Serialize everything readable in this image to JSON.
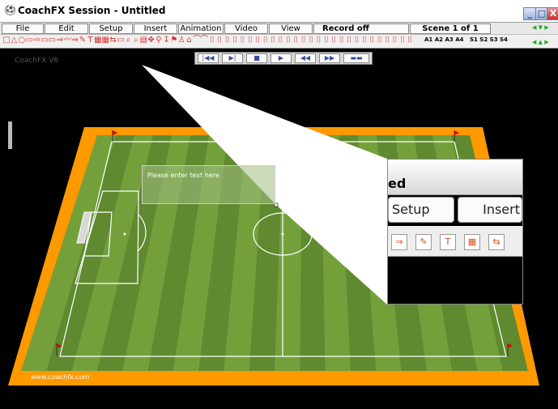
{
  "window": {
    "title": "CoachFX Session - Untitled",
    "app_icon": "soccer-ball-icon"
  },
  "window_controls": {
    "minimize": "_",
    "maximize": "□",
    "close": "X"
  },
  "menus": [
    {
      "label": "File"
    },
    {
      "label": "Edit"
    },
    {
      "label": "Setup"
    },
    {
      "label": "Insert"
    },
    {
      "label": "Animation"
    },
    {
      "label": "Video"
    },
    {
      "label": "View"
    }
  ],
  "status": {
    "record": "Record off",
    "scene": "Scene  1 of 1"
  },
  "toolbar_icons": [
    "□",
    "△",
    "○",
    "▭",
    "⇨",
    "▭",
    "▭",
    "⇒",
    "〰",
    "⇒",
    "✎",
    "T",
    "▦",
    "▦",
    "⇆",
    "▭",
    "⌕",
    "⌕",
    "▤",
    "✥",
    "⚲",
    "↧",
    "⚑",
    "♙",
    "⌂",
    "⌒",
    "⌒",
    "⌷",
    "⌷",
    "⌷",
    "⌷",
    "⌷",
    "⌷",
    "⌷",
    "⌷",
    "⌷",
    "⌷",
    "⌷",
    "⌷",
    "⌷",
    "⌷",
    "⌷",
    "⌷",
    "⌷",
    "⌷",
    "⌷",
    "⌷",
    "⌷",
    "⌷",
    "⌷",
    "⌷",
    "⌷",
    "⌷",
    "⌷"
  ],
  "toolbar_labels": {
    "a1": "A1",
    "a2": "A2",
    "a3": "A3",
    "a4": "A4",
    "s1": "S1",
    "s2": "S2",
    "s3": "S3",
    "s4": "S4"
  },
  "playback": {
    "first": "|◀◀",
    "prev": "▶|",
    "stop": "■",
    "play": "▶",
    "rew": "◀◀",
    "ff": "▶▶",
    "film": "▬▬"
  },
  "version_label": "CoachFX V6",
  "pitch": {
    "text_box": "Please enter text here",
    "website": "www.coachfx.com"
  },
  "zoom_preview": {
    "title": "ed",
    "menus": [
      "Setup",
      "Insert"
    ],
    "icons": [
      "⇒",
      "✎",
      "T",
      "▦",
      "⇆"
    ]
  },
  "colors": {
    "pitch_dark": "#5f8a30",
    "pitch_light": "#74a03c",
    "border": "#ff9900"
  }
}
